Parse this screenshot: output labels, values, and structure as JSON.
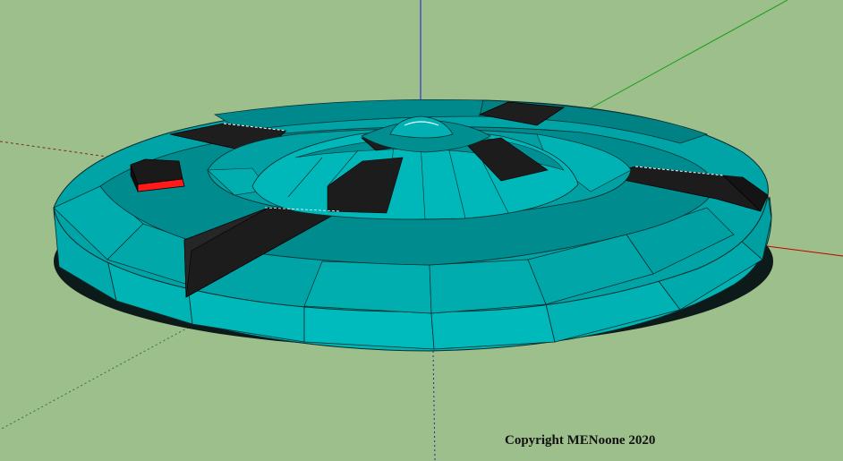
{
  "copyright": "Copyright MENoone 2020",
  "colors": {
    "background": "#9cbf8c",
    "hull_teal": "#00a3a6",
    "hull_light": "#00b9bb",
    "hull_dark": "#00797c",
    "panel_black": "#1a1a1a",
    "axis_red": "#c00000",
    "axis_green": "#1aa01a",
    "axis_blue": "#1a1adc",
    "marker_red": "#ff1a1a"
  }
}
